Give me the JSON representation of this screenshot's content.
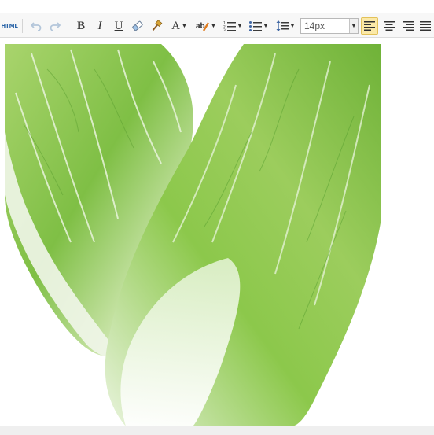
{
  "toolbar": {
    "html_label": "HTML",
    "bold_label": "B",
    "italic_label": "I",
    "underline_label": "U",
    "font_color_label": "A",
    "font_size_value": "14px"
  },
  "icons": [
    "html-source-icon",
    "undo-icon",
    "redo-icon",
    "bold-icon",
    "italic-icon",
    "underline-icon",
    "eraser-icon",
    "format-painter-icon",
    "font-color-icon",
    "highlight-color-icon",
    "ordered-list-icon",
    "unordered-list-icon",
    "line-height-icon",
    "align-left-icon",
    "align-center-icon",
    "align-right-icon",
    "justify-icon"
  ],
  "colors": {
    "toolbar_bg": "#f7f7f7",
    "active_bg": "#fbe9a8",
    "html_text": "#2b65a8",
    "cabbage_leaf": "#8cc84b",
    "cabbage_dark": "#4f9a2b",
    "cabbage_stem": "#eef6e6"
  },
  "content": {
    "image_subject": "napa-cabbage-photo"
  }
}
